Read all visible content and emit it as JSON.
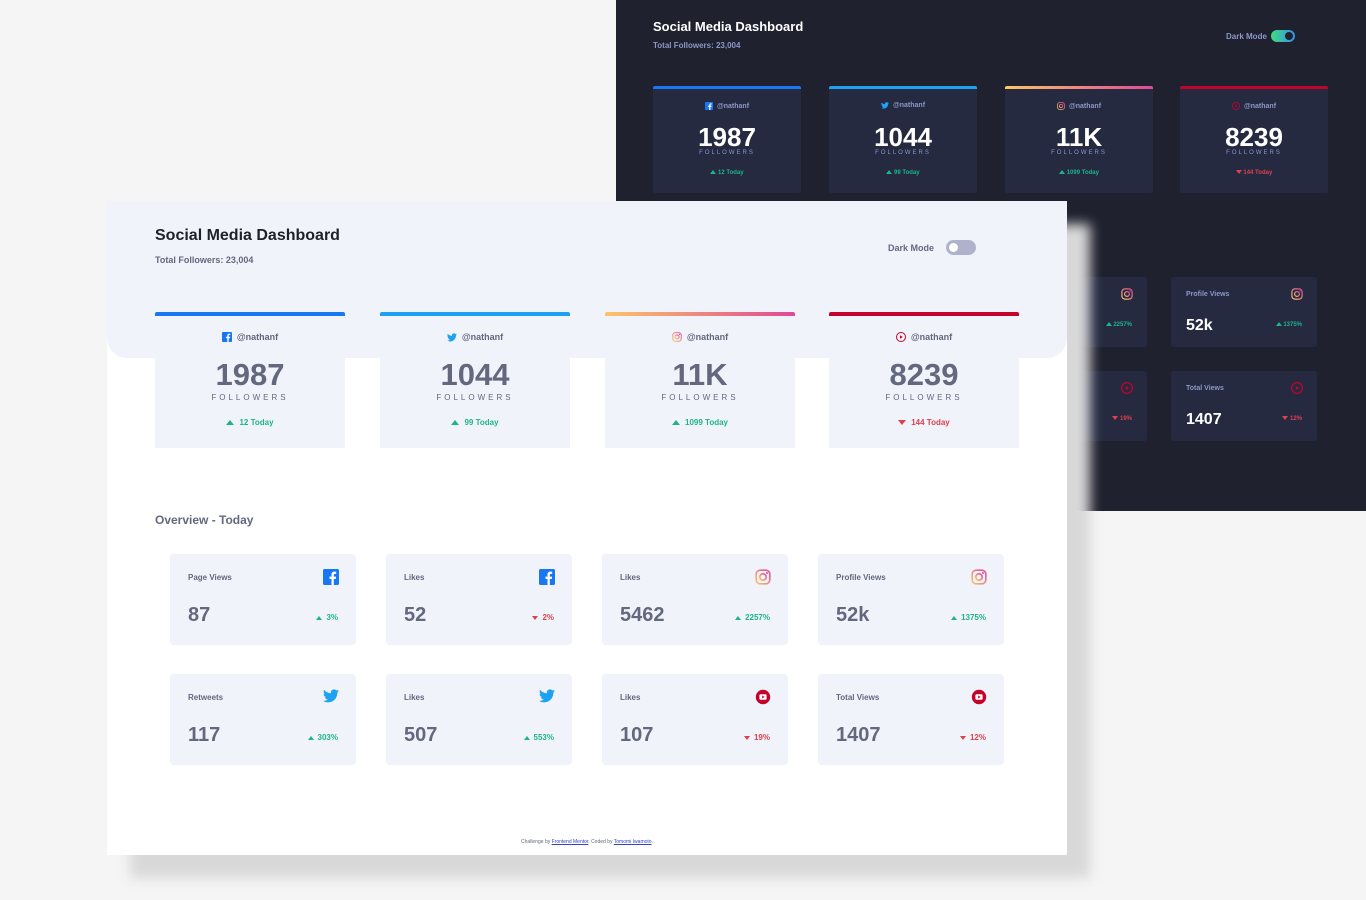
{
  "dark": {
    "title": "Social Media Dashboard",
    "total": "Total Followers: 23,004",
    "toggle_label": "Dark Mode",
    "cards": [
      {
        "network": "facebook",
        "handle": "@nathanf",
        "count": "1987",
        "label": "FOLLOWERS",
        "change": "12 Today",
        "trend": "up"
      },
      {
        "network": "twitter",
        "handle": "@nathanf",
        "count": "1044",
        "label": "FOLLOWERS",
        "change": "99 Today",
        "trend": "up"
      },
      {
        "network": "instagram",
        "handle": "@nathanf",
        "count": "11K",
        "label": "FOLLOWERS",
        "change": "1099 Today",
        "trend": "up"
      },
      {
        "network": "youtube",
        "handle": "@nathanf",
        "count": "8239",
        "label": "FOLLOWERS",
        "change": "144 Today",
        "trend": "down"
      }
    ],
    "minis": [
      {
        "title": "",
        "value": "",
        "change": "2257%",
        "trend": "up",
        "network": "instagram"
      },
      {
        "title": "Profile Views",
        "value": "52k",
        "change": "1375%",
        "trend": "up",
        "network": "instagram"
      },
      {
        "title": "",
        "value": "",
        "change": "19%",
        "trend": "down",
        "network": "youtube"
      },
      {
        "title": "Total Views",
        "value": "1407",
        "change": "12%",
        "trend": "down",
        "network": "youtube"
      }
    ]
  },
  "light": {
    "title": "Social Media Dashboard",
    "total": "Total Followers: 23,004",
    "toggle_label": "Dark Mode",
    "cards": [
      {
        "network": "facebook",
        "handle": "@nathanf",
        "count": "1987",
        "label": "FOLLOWERS",
        "change": "12 Today",
        "trend": "up"
      },
      {
        "network": "twitter",
        "handle": "@nathanf",
        "count": "1044",
        "label": "FOLLOWERS",
        "change": "99 Today",
        "trend": "up"
      },
      {
        "network": "instagram",
        "handle": "@nathanf",
        "count": "11K",
        "label": "FOLLOWERS",
        "change": "1099 Today",
        "trend": "up"
      },
      {
        "network": "youtube",
        "handle": "@nathanf",
        "count": "8239",
        "label": "FOLLOWERS",
        "change": "144 Today",
        "trend": "down"
      }
    ],
    "overview_title": "Overview - Today",
    "overview": [
      {
        "title": "Page Views",
        "value": "87",
        "change": "3%",
        "trend": "up",
        "network": "facebook"
      },
      {
        "title": "Likes",
        "value": "52",
        "change": "2%",
        "trend": "down",
        "network": "facebook"
      },
      {
        "title": "Likes",
        "value": "5462",
        "change": "2257%",
        "trend": "up",
        "network": "instagram"
      },
      {
        "title": "Profile Views",
        "value": "52k",
        "change": "1375%",
        "trend": "up",
        "network": "instagram"
      },
      {
        "title": "Retweets",
        "value": "117",
        "change": "303%",
        "trend": "up",
        "network": "twitter"
      },
      {
        "title": "Likes",
        "value": "507",
        "change": "553%",
        "trend": "up",
        "network": "twitter"
      },
      {
        "title": "Likes",
        "value": "107",
        "change": "19%",
        "trend": "down",
        "network": "youtube"
      },
      {
        "title": "Total Views",
        "value": "1407",
        "change": "12%",
        "trend": "down",
        "network": "youtube"
      }
    ],
    "footer": {
      "prefix": "Challenge by ",
      "link1": "Frontend Mentor",
      "middle": ". Coded by ",
      "link2": "Tomomi Iwamoto",
      "suffix": "."
    }
  },
  "colors": {
    "facebook": "#1877f2",
    "twitter": "#1da1f2",
    "instagram_start": "#fdc468",
    "instagram_end": "#df4996",
    "youtube": "#c4032b",
    "up": "#1db489",
    "down": "#dc414c"
  }
}
